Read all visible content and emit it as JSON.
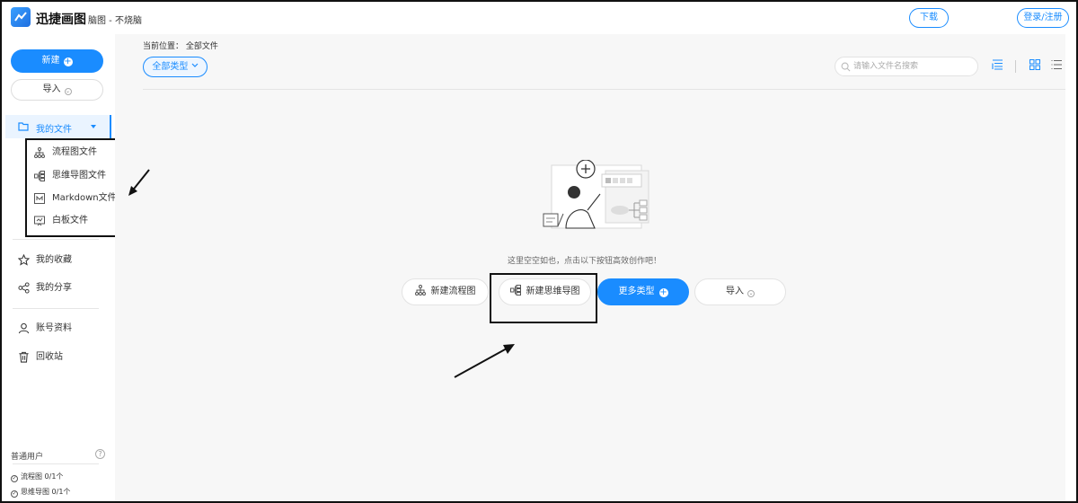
{
  "header": {
    "brand": "迅捷画图",
    "doc_title": "脑图 - 不烧脑",
    "download_label": "下载",
    "login_label": "登录/注册"
  },
  "sidebar": {
    "new_label": "新建",
    "import_label": "导入",
    "my_files_label": "我的文件",
    "submenu": [
      {
        "label": "流程图文件",
        "icon": "flowchart-icon"
      },
      {
        "label": "思维导图文件",
        "icon": "mindmap-icon"
      },
      {
        "label": "Markdown文件",
        "icon": "markdown-icon"
      },
      {
        "label": "白板文件",
        "icon": "whiteboard-icon"
      }
    ],
    "nav": [
      {
        "label": "我的收藏",
        "icon": "star-icon"
      },
      {
        "label": "我的分享",
        "icon": "share-icon"
      },
      {
        "label": "账号资料",
        "icon": "user-icon"
      },
      {
        "label": "回收站",
        "icon": "trash-icon"
      }
    ],
    "user_type": "普通用户",
    "help": "?",
    "quota": [
      {
        "label": "流程图 0/1个"
      },
      {
        "label": "思维导图 0/1个"
      }
    ]
  },
  "main": {
    "breadcrumb": "当前位置： 全部文件",
    "filter_label": "全部类型",
    "search_placeholder": "请输入文件名搜索",
    "empty_text": "这里空空如也，点击以下按钮高效创作吧！",
    "actions": {
      "new_flowchart": "新建流程图",
      "new_mindmap": "新建思维导图",
      "more_types": "更多类型",
      "import": "导入"
    }
  },
  "colors": {
    "accent": "#1a8cff",
    "main_bg": "#f7f7f7",
    "highlight_bg": "#eaf4ff"
  }
}
